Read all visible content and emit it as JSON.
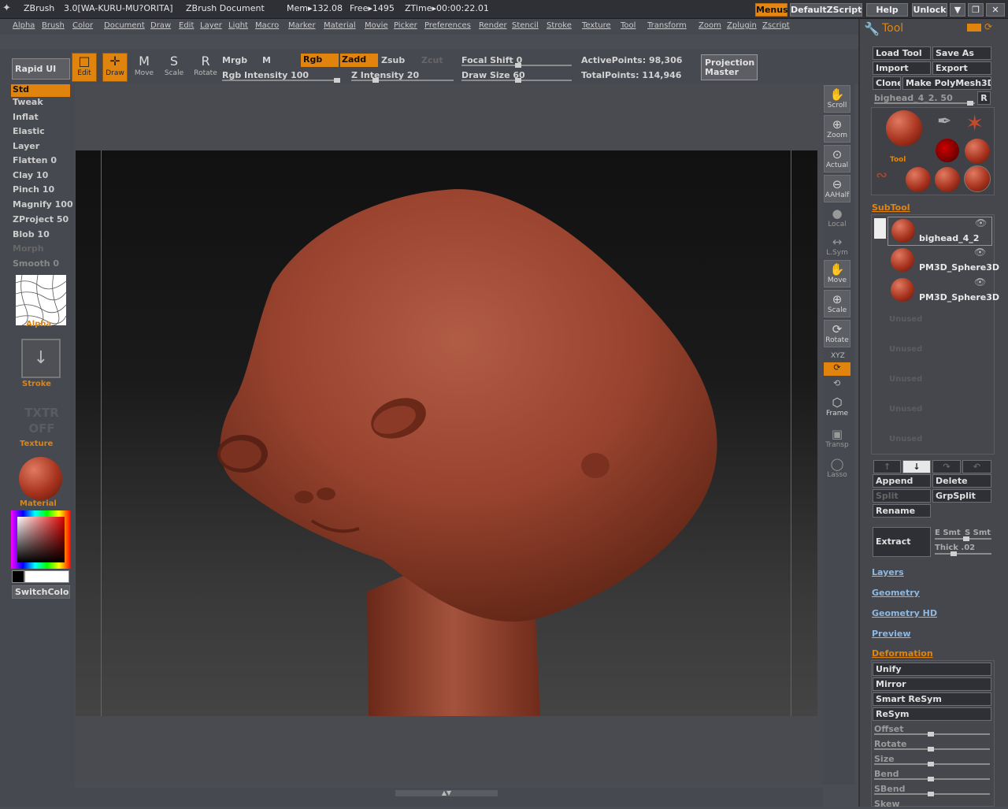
{
  "titlebar": {
    "app": "ZBrush",
    "version": "3.0[WA-KURU-MU?ORITA]",
    "document": "ZBrush Document",
    "mem": "Mem▸132.08",
    "free": "Free▸1495",
    "ztime": "ZTime▸00:00:22.01",
    "buttons": [
      "Menus",
      "DefaultZScript",
      "Help",
      "Unlock"
    ],
    "win_controls": [
      "▼",
      "❐",
      "✕"
    ]
  },
  "menus": [
    "Alpha",
    "Brush",
    "Color",
    "Document",
    "Draw",
    "Edit",
    "Layer",
    "Light",
    "Macro",
    "Marker",
    "Material",
    "Movie",
    "Picker",
    "Preferences",
    "Render",
    "Stencil",
    "Stroke",
    "Texture",
    "Tool",
    "Transform",
    "Zoom",
    "Zplugin",
    "Zscript"
  ],
  "toolbar": {
    "rapid_ui": "Rapid UI",
    "edit": "Edit",
    "draw": "Draw",
    "move": "Move",
    "scale": "Scale",
    "rotate": "Rotate",
    "mrgb": "Mrgb",
    "m": "M",
    "rgb": "Rgb",
    "zadd": "Zadd",
    "zsub": "Zsub",
    "zcut": "Zcut",
    "rgb_intensity": "Rgb Intensity 100",
    "z_intensity": "Z Intensity 20",
    "focal_shift": "Focal Shift 0",
    "draw_size": "Draw Size 60",
    "active_points": "ActivePoints: 98,306",
    "total_points": "TotalPoints: 114,946",
    "projection_master": "Projection Master"
  },
  "brushes": [
    "Std",
    "Tweak",
    "Inflat",
    "Elastic",
    "Layer",
    "Flatten 0",
    "Clay 10",
    "Pinch 10",
    "Magnify 100",
    "ZProject 50",
    "Blob 10",
    "Morph",
    "Smooth 0"
  ],
  "left": {
    "alpha": "Alpha",
    "stroke": "Stroke",
    "txtr_off": "TXTR OFF",
    "texture": "Texture",
    "material": "Material",
    "switch_color": "SwitchColor"
  },
  "shelf": [
    "Scroll",
    "Zoom",
    "Actual",
    "AAHalf",
    "Local",
    "L.Sym",
    "Move",
    "Scale",
    "Rotate",
    "XYZ",
    "Frame",
    "Transp",
    "Lasso"
  ],
  "tool": {
    "title": "Tool",
    "load_tool": "Load Tool",
    "save_as": "Save As",
    "import": "Import",
    "export": "Export",
    "clone": "Clone",
    "make_polymesh": "Make PolyMesh3D",
    "current": "bighead_4_2. 50",
    "r": "R",
    "tool_label": "Tool"
  },
  "subtool": {
    "title": "SubTool",
    "items": [
      "bighead_4_2",
      "PM3D_Sphere3D",
      "PM3D_Sphere3D"
    ],
    "unused": "Unused",
    "append": "Append",
    "delete": "Delete",
    "split": "Split",
    "grpsplit": "GrpSplit",
    "rename": "Rename",
    "extract": "Extract",
    "e_smt": "E Smt",
    "s_smt": "S Smt",
    "thick": "Thick .02"
  },
  "sections": [
    "Layers",
    "Geometry",
    "Geometry HD",
    "Preview"
  ],
  "deformation": {
    "title": "Deformation",
    "buttons": [
      "Unify",
      "Mirror",
      "Smart ReSym",
      "ReSym"
    ],
    "sliders": [
      "Offset",
      "Rotate",
      "Size",
      "Bend",
      "SBend",
      "Skew"
    ]
  }
}
